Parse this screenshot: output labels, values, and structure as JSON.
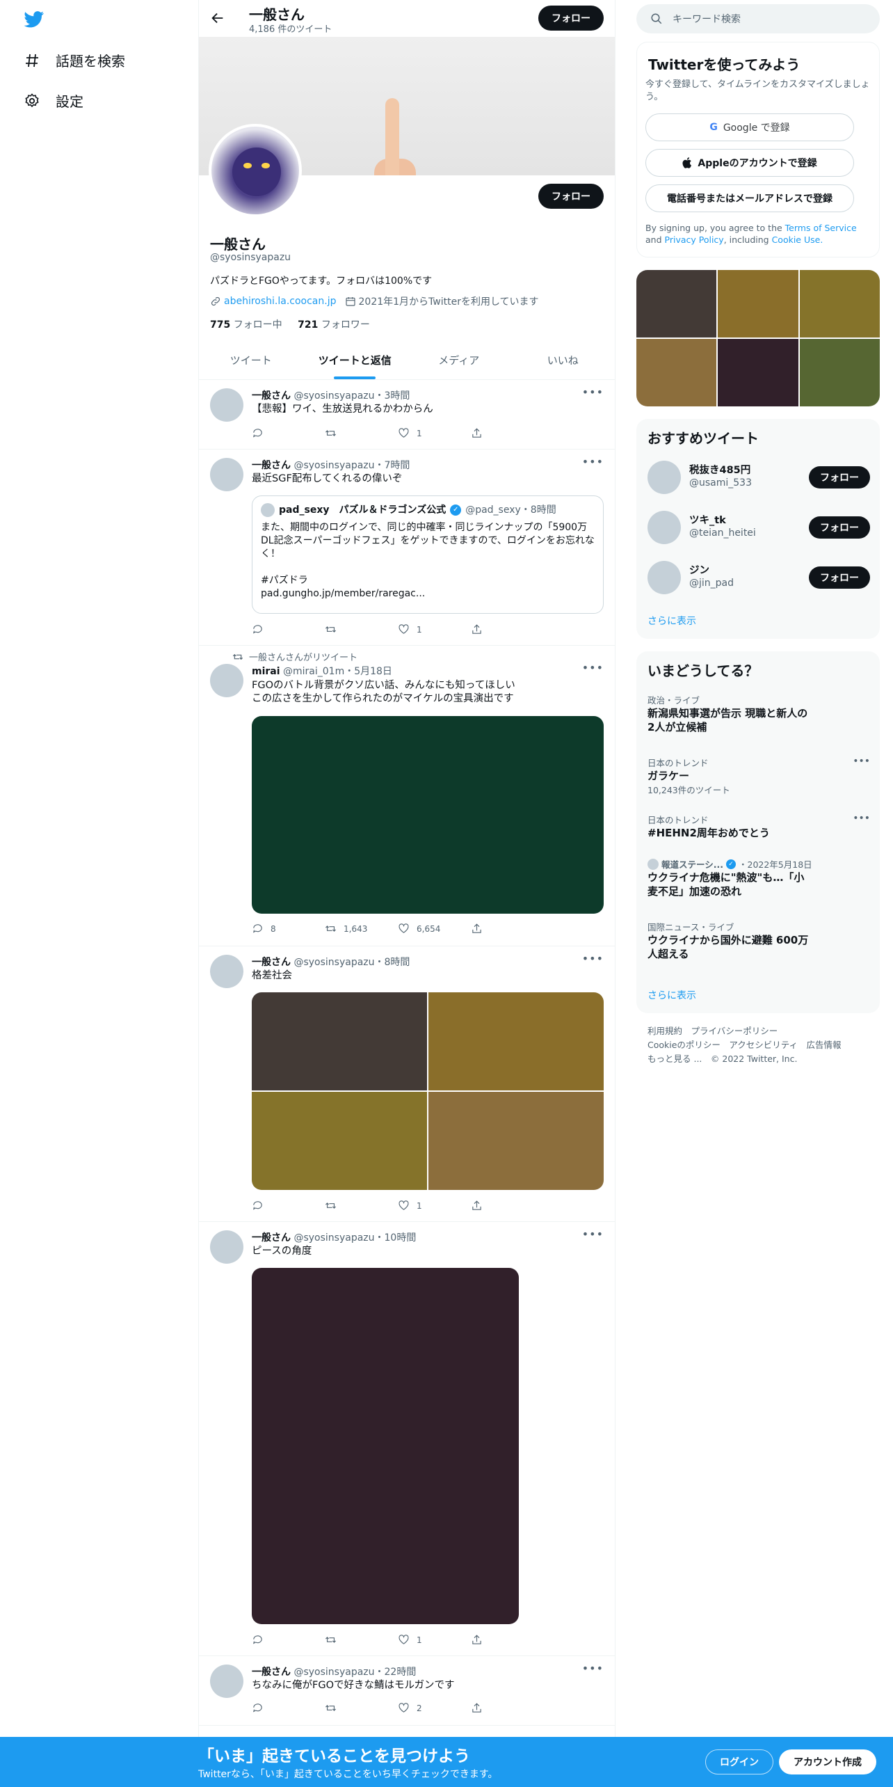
{
  "sidebar": {
    "items": [
      {
        "label": "話題を検索",
        "icon": "hashtag-icon"
      },
      {
        "label": "設定",
        "icon": "gear-icon"
      }
    ]
  },
  "header": {
    "name": "一般さん",
    "tweet_count": "4,186 件のツイート",
    "follow_label": "フォロー"
  },
  "profile": {
    "name": "一般さん",
    "handle": "@syosinsyapazu",
    "bio": "パズドラとFGOやってます。フォロバは100%です",
    "link": "abehiroshi.la.coocan.jp",
    "joined": "2021年1月からTwitterを利用しています",
    "following_count": "775",
    "following_label": "フォロー中",
    "followers_count": "721",
    "followers_label": "フォロワー",
    "follow_label": "フォロー"
  },
  "tabs": [
    "ツイート",
    "ツイートと返信",
    "メディア",
    "いいね"
  ],
  "tweets": [
    {
      "name": "一般さん",
      "meta": "@syosinsyapazu・3時間",
      "text": "【悲報】ワイ、生放送見れるかわからん",
      "reply": "",
      "retweet": "",
      "like": "1"
    },
    {
      "name": "一般さん",
      "meta": "@syosinsyapazu・7時間",
      "text": "最近SGF配布してくれるの偉いぞ",
      "reply": "",
      "retweet": "",
      "like": "1",
      "quote": {
        "name": "pad_sexy　パズル＆ドラゴンズ公式",
        "meta": "@pad_sexy・8時間",
        "text": "また、期間中のログインで、同じ的中確率・同じラインナップの「5900万DL記念スーパーゴッドフェス」をゲットできますので、ログインをお忘れなく！\n\n#パズドラ\npad.gungho.jp/member/raregac..."
      }
    },
    {
      "retweeted_by": "一般さんさんがリツイート",
      "name": "mirai",
      "meta": "@mirai_01m・5月18日",
      "text": "FGOのバトル背景がクソ広い話、みんなにも知ってほしい\nこの広さを生かして作られたのがマイケルの宝具演出です",
      "reply": "8",
      "retweet": "1,643",
      "like": "6,654"
    },
    {
      "name": "一般さん",
      "meta": "@syosinsyapazu・8時間",
      "text": "格差社会",
      "reply": "",
      "retweet": "",
      "like": "1"
    },
    {
      "name": "一般さん",
      "meta": "@syosinsyapazu・10時間",
      "text": "ピースの角度",
      "reply": "",
      "retweet": "",
      "like": "1"
    },
    {
      "name": "一般さん",
      "meta": "@syosinsyapazu・22時間",
      "text": "ちなみに俺がFGOで好きな鯖はモルガンです",
      "reply": "",
      "retweet": "",
      "like": "2"
    }
  ],
  "search": {
    "placeholder": "キーワード検索"
  },
  "signup": {
    "title": "Twitterを使ってみよう",
    "subtitle": "今すぐ登録して、タイムラインをカスタマイズしましょう。",
    "google": "Google で登録",
    "apple": "Appleのアカウントで登録",
    "phone": "電話番号またはメールアドレスで登録",
    "legal_pre": "By signing up, you agree to the",
    "tos": "Terms of Service",
    "and": "and",
    "privacy": "Privacy Policy",
    "including": ", including",
    "cookie": "Cookie Use."
  },
  "who_to_follow": {
    "title": "おすすめツイート",
    "users": [
      {
        "name": "税抜き485円",
        "handle": "@usami_533"
      },
      {
        "name": "ツキ_tk",
        "handle": "@teian_heitei"
      },
      {
        "name": "ジン",
        "handle": "@jin_pad"
      }
    ],
    "follow_label": "フォロー",
    "more": "さらに表示"
  },
  "trends": {
    "title": "いまどうしてる？",
    "items": [
      {
        "category": "政治・ライブ",
        "title": "新潟県知事選が告示 現職と新人の2人が立候補"
      },
      {
        "category": "日本のトレンド",
        "title": "ガラケー",
        "count": "10,243件のツイート"
      },
      {
        "category": "日本のトレンド",
        "title": "#HEHN2周年おめでとう"
      },
      {
        "category": "報道ステーシ...",
        "date": "・2022年5月18日",
        "title": "ウクライナ危機に\"熱波\"も…「小麦不足」加速の恐れ"
      },
      {
        "category": "国際ニュース・ライブ",
        "title": "ウクライナから国外に避難 600万人超える"
      }
    ],
    "more": "さらに表示"
  },
  "footer": {
    "line1": "利用規約　プライバシーポリシー",
    "line2": "Cookieのポリシー　アクセシビリティ　広告情報",
    "line3": "もっと見る ...　© 2022 Twitter, Inc."
  },
  "bottom": {
    "title": "「いま」起きていることを見つけよう",
    "subtitle": "Twitterなら、「いま」起きていることをいち早くチェックできます。",
    "login": "ログイン",
    "create": "アカウント作成"
  },
  "colors": {
    "accent": "#1d9bf0",
    "dark": "#0f1419",
    "muted": "#536471"
  },
  "media_colors": {
    "mirai": "#0d3a2a",
    "kakusa": [
      "#433a36",
      "#8a6e2a",
      "#85732a",
      "#8c6e3c"
    ],
    "peace": "#31202a",
    "grid6": [
      "#433a36",
      "#8a6e2a",
      "#85732a",
      "#8c6e3c",
      "#31202a",
      "#566632"
    ]
  }
}
